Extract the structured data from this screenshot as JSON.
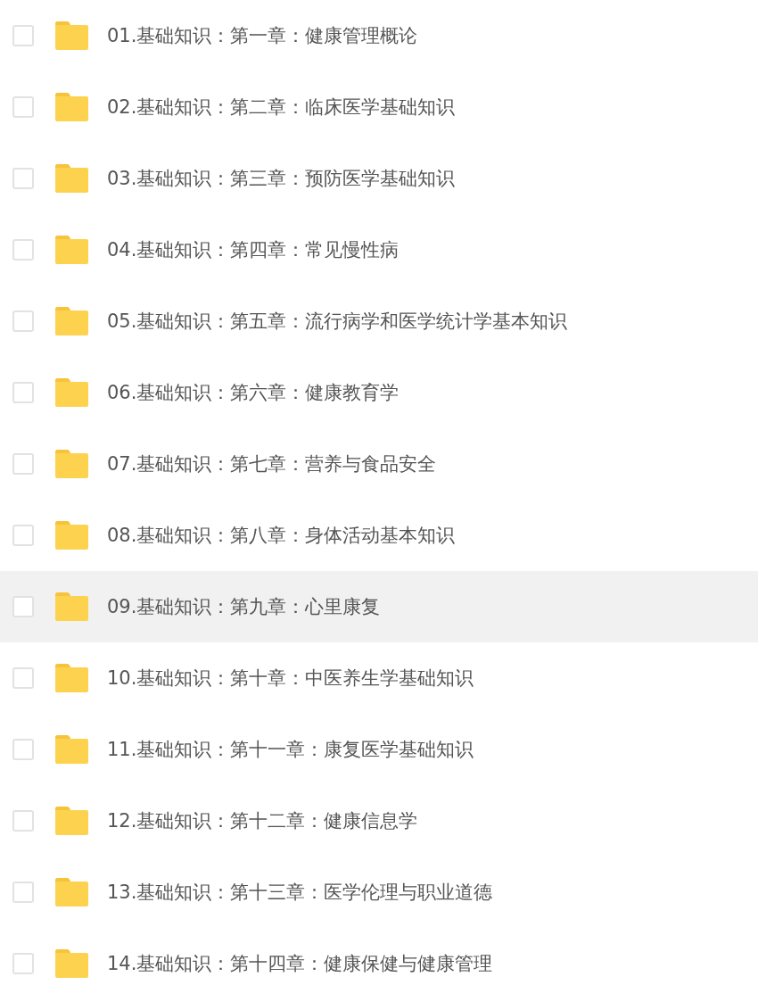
{
  "files": [
    {
      "name": "01.基础知识：第一章：健康管理概论",
      "checked": false,
      "highlighted": false
    },
    {
      "name": "02.基础知识：第二章：临床医学基础知识",
      "checked": false,
      "highlighted": false
    },
    {
      "name": "03.基础知识：第三章：预防医学基础知识",
      "checked": false,
      "highlighted": false
    },
    {
      "name": "04.基础知识：第四章：常见慢性病",
      "checked": false,
      "highlighted": false
    },
    {
      "name": "05.基础知识：第五章：流行病学和医学统计学基本知识",
      "checked": false,
      "highlighted": false
    },
    {
      "name": "06.基础知识：第六章：健康教育学",
      "checked": false,
      "highlighted": false
    },
    {
      "name": "07.基础知识：第七章：营养与食品安全",
      "checked": false,
      "highlighted": false
    },
    {
      "name": "08.基础知识：第八章：身体活动基本知识",
      "checked": false,
      "highlighted": false
    },
    {
      "name": "09.基础知识：第九章：心里康复",
      "checked": false,
      "highlighted": true
    },
    {
      "name": "10.基础知识：第十章：中医养生学基础知识",
      "checked": false,
      "highlighted": false
    },
    {
      "name": "11.基础知识：第十一章：康复医学基础知识",
      "checked": false,
      "highlighted": false
    },
    {
      "name": "12.基础知识：第十二章：健康信息学",
      "checked": false,
      "highlighted": false
    },
    {
      "name": "13.基础知识：第十三章：医学伦理与职业道德",
      "checked": false,
      "highlighted": false
    },
    {
      "name": "14.基础知识：第十四章：健康保健与健康管理",
      "checked": false,
      "highlighted": false
    }
  ]
}
